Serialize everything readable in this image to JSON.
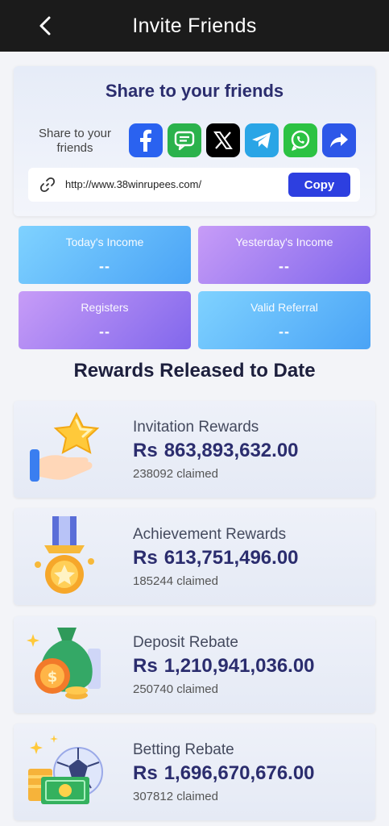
{
  "header": {
    "title": "Invite Friends"
  },
  "share": {
    "title": "Share to your friends",
    "label": "Share to your friends",
    "platforms": [
      {
        "name": "facebook",
        "color": "#2a62f0"
      },
      {
        "name": "sms",
        "color": "#2bb24c"
      },
      {
        "name": "x",
        "color": "#000000"
      },
      {
        "name": "telegram",
        "color": "#2aa5e6"
      },
      {
        "name": "whatsapp",
        "color": "#2cc243"
      },
      {
        "name": "share",
        "color": "#2d57e8"
      }
    ],
    "link": "http://www.38winrupees.com/",
    "copy_label": "Copy"
  },
  "stats": {
    "today": {
      "label": "Today's Income",
      "value": "--"
    },
    "yesterday": {
      "label": "Yesterday's Income",
      "value": "--"
    },
    "registers": {
      "label": "Registers",
      "value": "--"
    },
    "valid_referral": {
      "label": "Valid Referral",
      "value": "--"
    }
  },
  "rewards_title": "Rewards Released to Date",
  "rewards": [
    {
      "name": "Invitation Rewards",
      "currency": "Rs",
      "amount": "863,893,632.00",
      "claimed": "238092 claimed",
      "icon": "hand-star-icon"
    },
    {
      "name": "Achievement Rewards",
      "currency": "Rs",
      "amount": "613,751,496.00",
      "claimed": "185244 claimed",
      "icon": "medal-icon"
    },
    {
      "name": "Deposit Rebate",
      "currency": "Rs",
      "amount": "1,210,941,036.00",
      "claimed": "250740 claimed",
      "icon": "money-bag-icon"
    },
    {
      "name": "Betting Rebate",
      "currency": "Rs",
      "amount": "1,696,670,676.00",
      "claimed": "307812 claimed",
      "icon": "ball-cash-icon"
    }
  ]
}
